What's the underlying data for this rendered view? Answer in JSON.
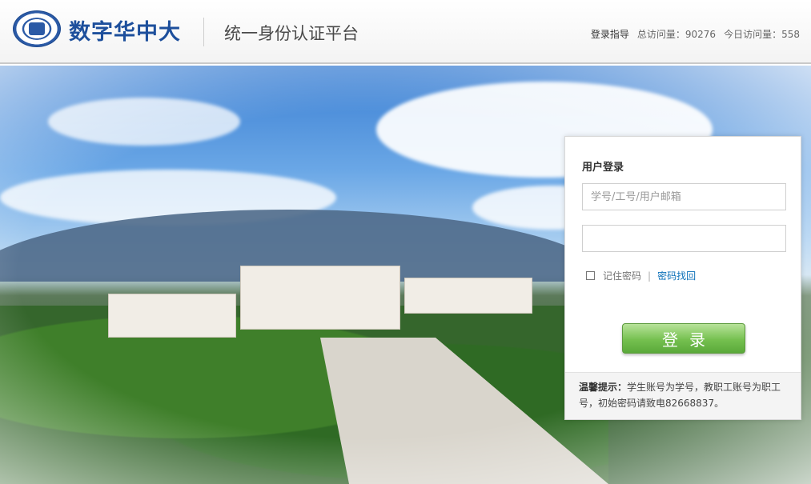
{
  "header": {
    "logo_title": "数字华中大",
    "platform_title": "统一身份认证平台",
    "guide_label": "登录指导",
    "total_visits_label": "总访问量：",
    "total_visits_value": "90276",
    "today_visits_label": "今日访问量：",
    "today_visits_value": "558"
  },
  "login": {
    "title": "用户登录",
    "username_placeholder": "学号/工号/用户邮箱",
    "username_value": "",
    "password_value": "",
    "remember_label": "记住密码",
    "separator": "|",
    "recover_label": "密码找回",
    "submit_label": "登录",
    "tip_label": "温馨提示：",
    "tip_text": "学生账号为学号，教职工账号为职工号，初始密码请致电82668837。"
  },
  "colors": {
    "brand_blue": "#1d4f9c",
    "button_green": "#75c04f",
    "link_blue": "#0a6fb8"
  }
}
